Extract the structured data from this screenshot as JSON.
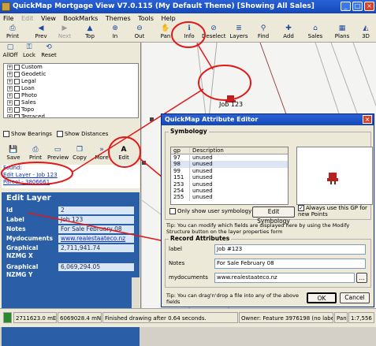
{
  "window": {
    "title": "QuickMap Mortgage View V7.0.115 (My Default Theme) [Showing All Sales]",
    "min": "_",
    "max": "□",
    "close": "×"
  },
  "menu": [
    "File",
    "Edit",
    "View",
    "BookMarks",
    "Themes",
    "Tools",
    "Help"
  ],
  "toolbar": [
    {
      "label": "Print",
      "icon": "printer-icon",
      "glyph": "⎙",
      "enabled": true
    },
    {
      "label": "Prev",
      "icon": "back-arrow-icon",
      "glyph": "◀",
      "enabled": true
    },
    {
      "label": "Next",
      "icon": "forward-arrow-icon",
      "glyph": "▶",
      "enabled": false
    },
    {
      "label": "Top",
      "icon": "top-icon",
      "glyph": "▲",
      "enabled": true
    },
    {
      "label": "In",
      "icon": "zoom-in-icon",
      "glyph": "⊕",
      "enabled": true
    },
    {
      "label": "Out",
      "icon": "zoom-out-icon",
      "glyph": "⊖",
      "enabled": true
    },
    {
      "label": "Pan",
      "icon": "pan-hand-icon",
      "glyph": "✋",
      "enabled": true
    },
    {
      "label": "Info",
      "icon": "info-icon",
      "glyph": "ℹ",
      "enabled": true
    },
    {
      "label": "Deselect",
      "icon": "deselect-icon",
      "glyph": "⊘",
      "enabled": true
    },
    {
      "label": "Layers",
      "icon": "layers-icon",
      "glyph": "≣",
      "enabled": true
    },
    {
      "label": "Find",
      "icon": "binoculars-icon",
      "glyph": "⚲",
      "enabled": true
    },
    {
      "label": "Add",
      "icon": "add-icon",
      "glyph": "✚",
      "enabled": true
    },
    {
      "label": "Sales",
      "icon": "sales-icon",
      "glyph": "⌂",
      "enabled": true
    },
    {
      "label": "Plans",
      "icon": "plans-icon",
      "glyph": "▦",
      "enabled": true
    },
    {
      "label": "3D",
      "icon": "3d-icon",
      "glyph": "◭",
      "enabled": true
    }
  ],
  "layer_toolbar": [
    "AllOff",
    "Lock",
    "Reset"
  ],
  "layers": [
    "Custom",
    "Geodetic",
    "Legal",
    "Loan",
    "Photo",
    "Sales",
    "Topo",
    "Terraced"
  ],
  "show_bearings": "Show Bearings",
  "show_distances": "Show Distances",
  "info_toolbar": [
    "Save",
    "Print",
    "Preview",
    "Copy",
    "More",
    "Edit"
  ],
  "found": {
    "label": "Found:",
    "link1": "Edit Layer - Job 123",
    "link2": "Parcel - 3806661"
  },
  "edit_layer": {
    "title": "Edit Layer",
    "rows": [
      {
        "k": "Id",
        "v": "2"
      },
      {
        "k": "Label",
        "v": "Job 123"
      },
      {
        "k": "Notes",
        "v": "For Sale February 08"
      },
      {
        "k": "Mydocuments",
        "v": "www.realestaateco.nz"
      },
      {
        "k": "Graphical NZMG X",
        "v": "2,711,941.74"
      },
      {
        "k": "Graphical NZMG Y",
        "v": "6,069,294.05"
      }
    ]
  },
  "map": {
    "label": "Job 123"
  },
  "dialog": {
    "title": "QuickMap Attribute Editor",
    "symbology_title": "Symbology",
    "table_headers": [
      "gp",
      "Description"
    ],
    "table_rows": [
      {
        "gp": "97",
        "d": "unused"
      },
      {
        "gp": "98",
        "d": "unused"
      },
      {
        "gp": "99",
        "d": "unused"
      },
      {
        "gp": "151",
        "d": "unused"
      },
      {
        "gp": "253",
        "d": "unused"
      },
      {
        "gp": "254",
        "d": "unused"
      },
      {
        "gp": "255",
        "d": "unused"
      }
    ],
    "only_user_symbology": "Only show user symbology",
    "edit_symbology": "Edit Symbology",
    "always_use": "Always use this GP for new Points",
    "tip1": "Tip: You can modify which fields are displayed here by using the Modify Structure button on the layer properties form",
    "record_title": "Record Attributes",
    "fields": [
      {
        "label": "label",
        "value": "Job #123"
      },
      {
        "label": "Notes",
        "value": "For Sale February 08"
      },
      {
        "label": "mydocuments",
        "value": "www.realestaateco.nz"
      }
    ],
    "browse": "...",
    "tip2": "Tip: You can drag'n'drop a file into any of the above fields",
    "ok": "OK",
    "cancel": "Cancel"
  },
  "status": {
    "coords": "2711623.0 mE",
    "north": "6069028.4 mN",
    "message": "Finished drawing after 0.64 seconds.",
    "owner": "Owner: Feature 3976198 (no label)",
    "pan": "Pan",
    "scale": "1:7,556"
  }
}
